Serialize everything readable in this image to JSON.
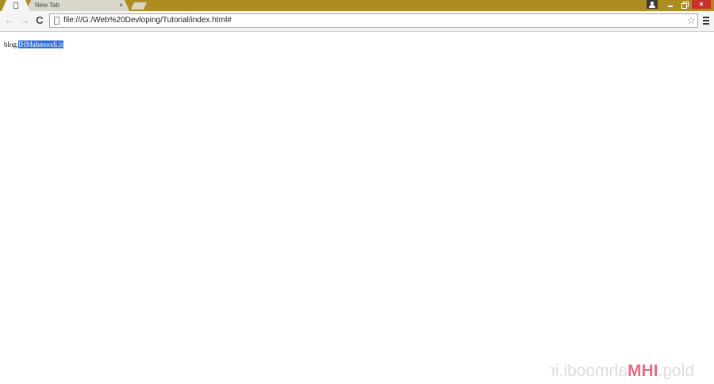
{
  "browser": {
    "tabs": [
      {
        "label": "",
        "active": true,
        "icon": "document-icon"
      },
      {
        "label": "New Tab",
        "active": false,
        "close": "×"
      }
    ],
    "window_controls": {
      "user": "user-icon",
      "minimize": "minimize-icon",
      "restore": "restore-icon",
      "close": "×"
    },
    "toolbar": {
      "back": "←",
      "forward": "→",
      "reload": "C",
      "url": "file:///G:/Web%20Devloping/Tutorial/index.html#",
      "bookmark_star": "☆"
    },
    "colors": {
      "titlebar": "#ad8d21",
      "selection": "#2f6fd6",
      "close_button": "#c9302c"
    }
  },
  "page": {
    "text_before_selection": "blog.",
    "selected_text": "IHMahmoodi.ir"
  },
  "watermark": {
    "prefix": "blog.",
    "accent": "IHM",
    "rest": "ahmoodi.ir"
  }
}
